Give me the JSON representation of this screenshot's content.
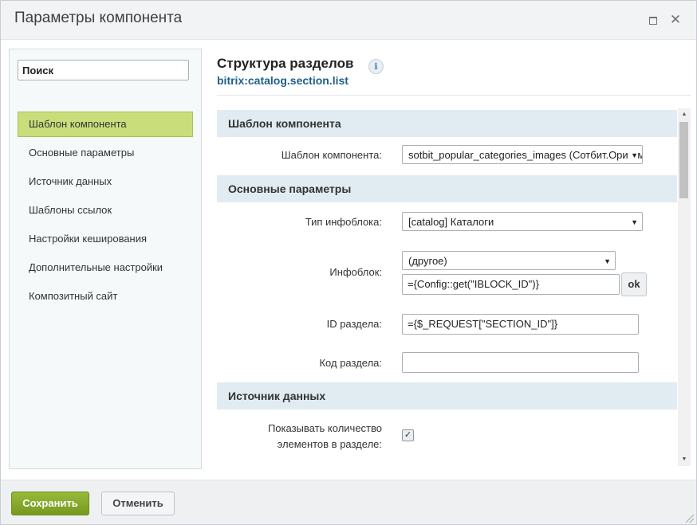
{
  "dialog": {
    "title": "Параметры компонента",
    "controls": {
      "maximize_icon": "maximize-icon",
      "close_icon": "close-icon",
      "close_glyph": "✕"
    }
  },
  "sidebar": {
    "search_value": "Поиск",
    "items": [
      {
        "label": "Шаблон компонента",
        "active": true
      },
      {
        "label": "Основные параметры",
        "active": false
      },
      {
        "label": "Источник данных",
        "active": false
      },
      {
        "label": "Шаблоны ссылок",
        "active": false
      },
      {
        "label": "Настройки кеширования",
        "active": false
      },
      {
        "label": "Дополнительные настройки",
        "active": false
      },
      {
        "label": "Композитный сайт",
        "active": false
      }
    ]
  },
  "component": {
    "title": "Структура разделов",
    "info_glyph": "i",
    "code": "bitrix:catalog.section.list"
  },
  "sections": {
    "template": {
      "title": "Шаблон компонента",
      "template_label": "Шаблон компонента:",
      "template_value": "sotbit_popular_categories_images (Сотбит.Оригами)"
    },
    "main": {
      "title": "Основные параметры",
      "iblock_type_label": "Тип инфоблока:",
      "iblock_type_value": "[catalog] Каталоги",
      "iblock_label": "Инфоблок:",
      "iblock_select_value": "(другое)",
      "iblock_input_value": "={Config::get(\"IBLOCK_ID\")}",
      "ok_label": "ok",
      "section_id_label": "ID раздела:",
      "section_id_value": "={$_REQUEST[\"SECTION_ID\"]}",
      "section_code_label": "Код раздела:",
      "section_code_value": ""
    },
    "data_source": {
      "title": "Источник данных",
      "count_label_line1": "Показывать количество",
      "count_label_line2": "элементов в разделе:",
      "count_checked": true,
      "check_glyph": "✓"
    }
  },
  "arrow_glyph": "▼",
  "scroll_up_glyph": "▲",
  "scroll_down_glyph": "▼",
  "footer": {
    "save_label": "Сохранить",
    "cancel_label": "Отменить"
  },
  "colors": {
    "save_button": "#82a42a",
    "active_nav": "#c9de7b",
    "section_header": "#e1ebf2",
    "component_code": "#1f5f8b"
  }
}
